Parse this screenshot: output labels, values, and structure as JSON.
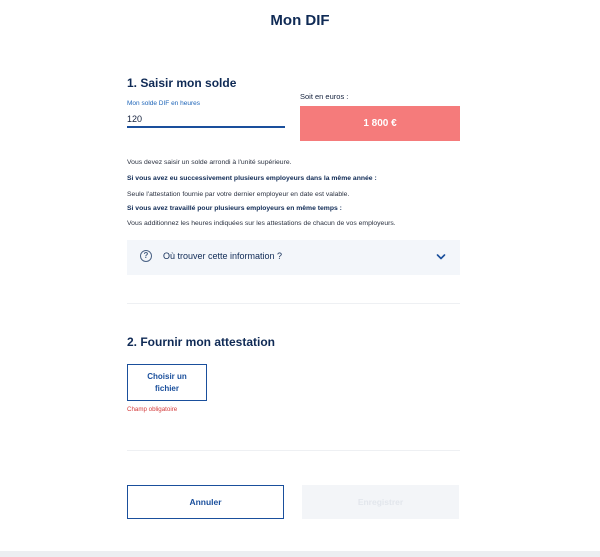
{
  "page": {
    "title": "Mon DIF"
  },
  "section1": {
    "title": "1. Saisir mon solde",
    "hours_label": "Mon solde DIF en heures",
    "hours_value": "120",
    "euros_label": "Soit en euros :",
    "euros_value": "1 800 €"
  },
  "info": {
    "lines": [
      "Vous devez saisir un solde arrondi à l'unité supérieure.",
      "Si vous avez eu successivement plusieurs employeurs dans la même année :",
      "Seule l'attestation fournie par votre dernier employeur en date est valable.",
      "Si vous avez travaillé pour plusieurs employeurs en même temps :",
      "Vous additionnez les heures indiquées sur les attestations de chacun de vos employeurs."
    ]
  },
  "accordion": {
    "label": "Où trouver cette information ?",
    "icon": "question-circle-icon",
    "toggle_icon": "chevron-down-icon"
  },
  "section2": {
    "title": "2. Fournir mon attestation",
    "file_button_label": "Choisir un fichier",
    "required_message": "Champ obligatoire"
  },
  "actions": {
    "cancel_label": "Annuler",
    "submit_label": "Enregistrer"
  },
  "colors": {
    "primary": "#1a4f9c",
    "title": "#0f2a55",
    "euros_bg": "#f57b7b",
    "error": "#d33a3a",
    "accordion_bg": "#f3f6fa"
  }
}
